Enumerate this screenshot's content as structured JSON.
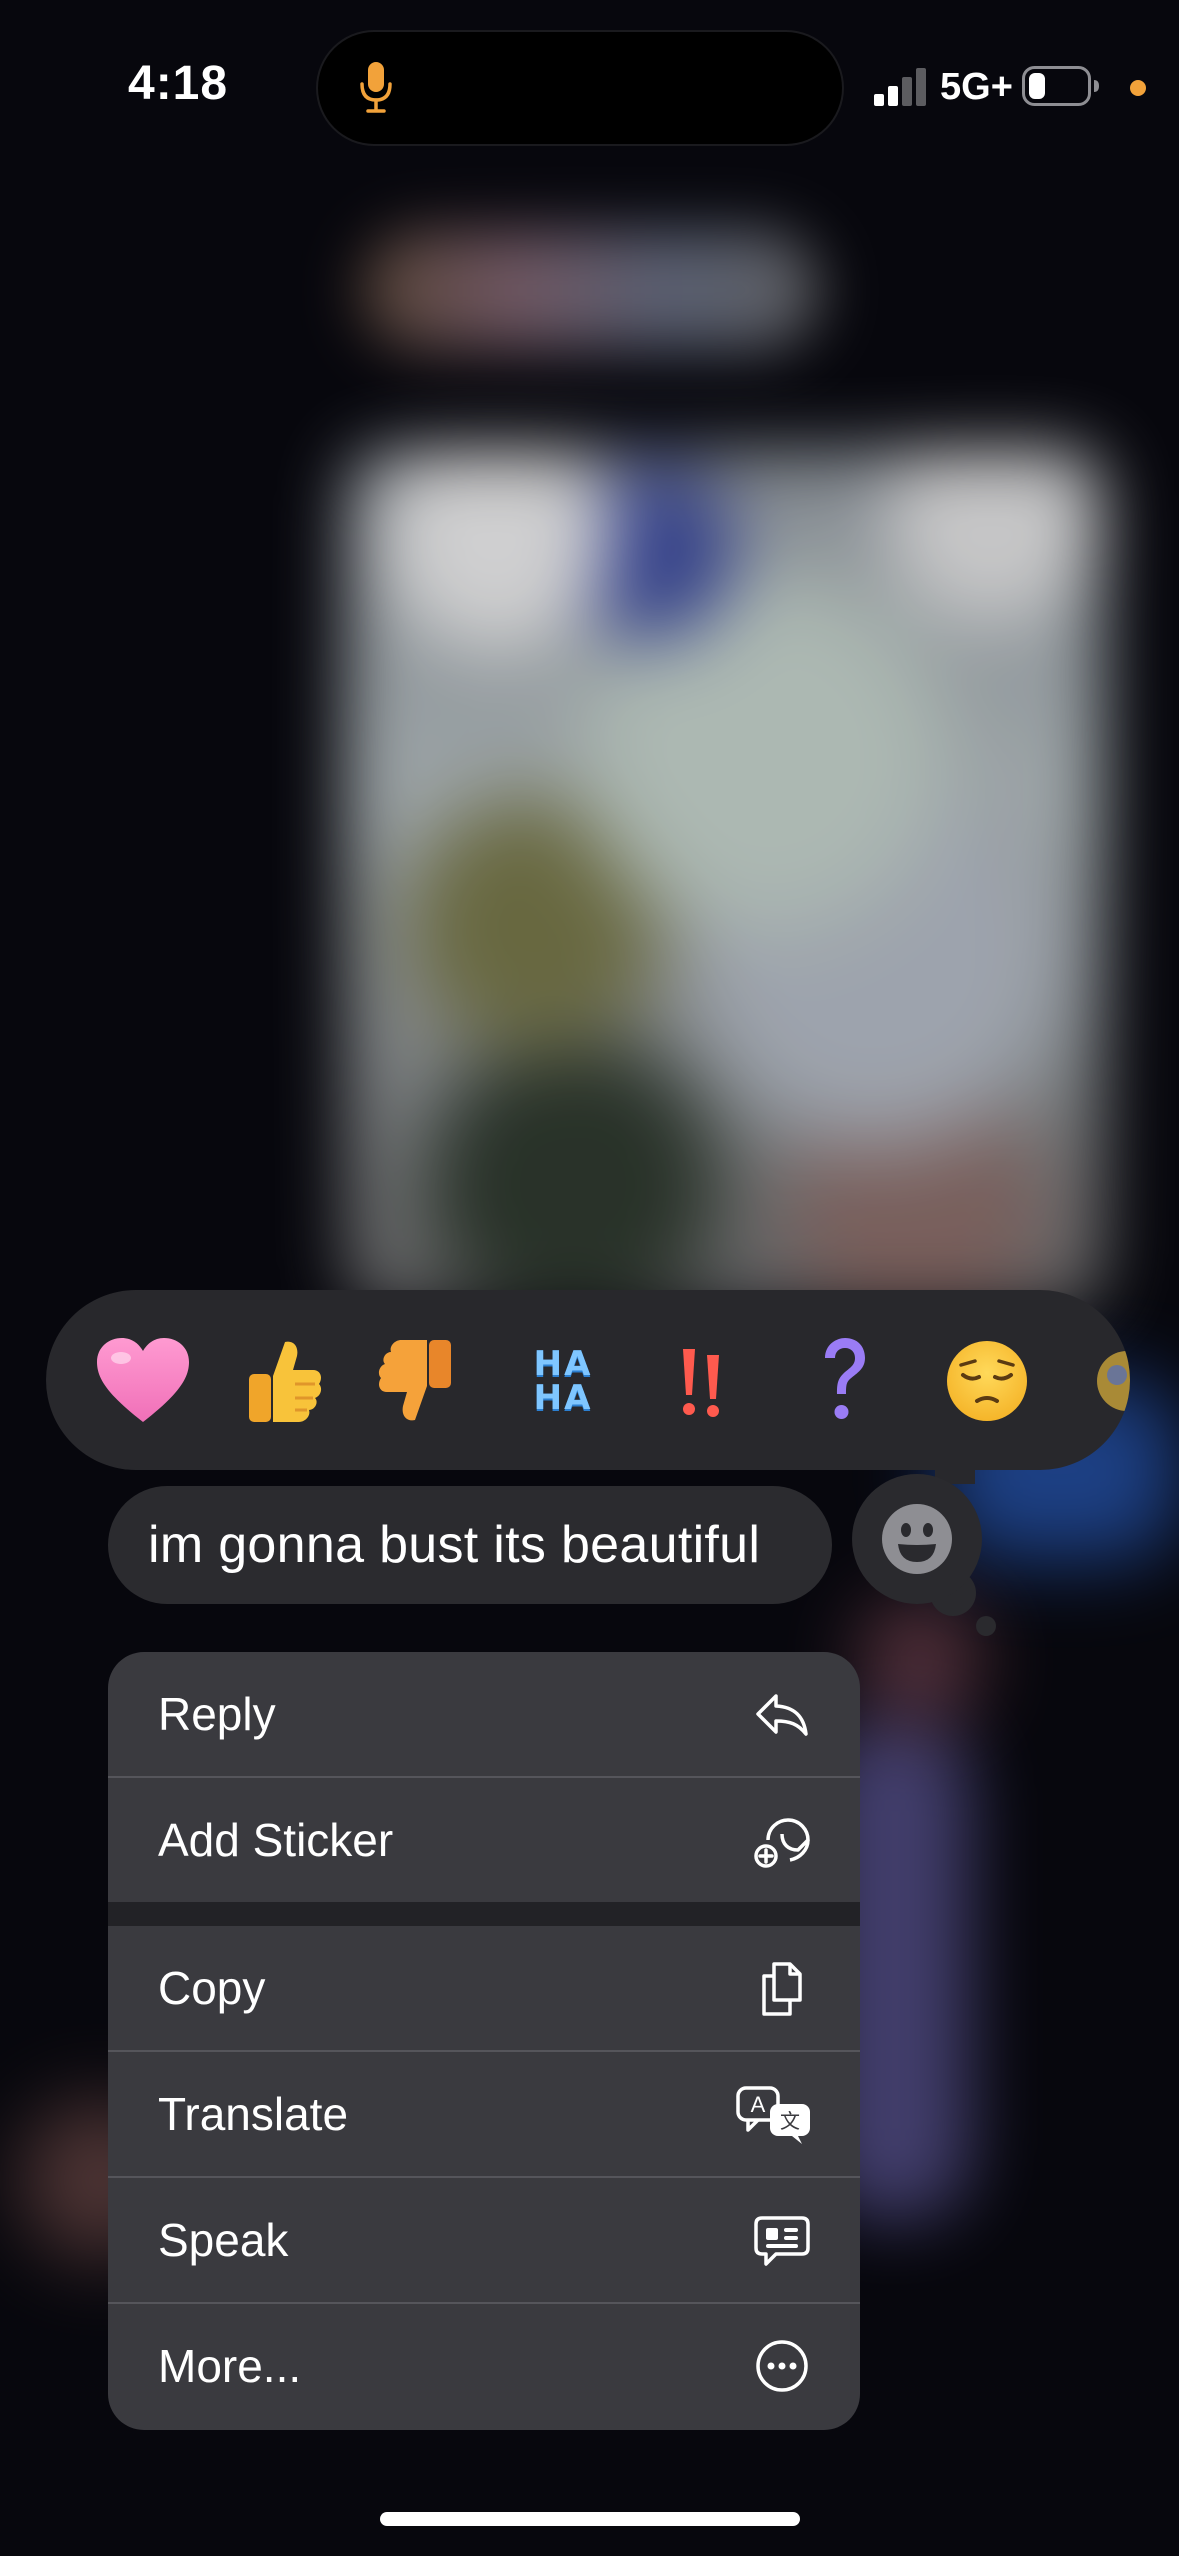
{
  "status_bar": {
    "time": "4:18",
    "network": "5G+",
    "mic_color": "#f2a23a",
    "privacy_dot_color": "#f2a23a"
  },
  "reactions": [
    {
      "name": "heart",
      "glyph": "❤️"
    },
    {
      "name": "thumbs-up",
      "glyph": "👍"
    },
    {
      "name": "thumbs-down",
      "glyph": "👎"
    },
    {
      "name": "haha",
      "line1": "HA",
      "line2": "HA"
    },
    {
      "name": "exclamation",
      "glyph": "‼"
    },
    {
      "name": "question",
      "glyph": "?"
    },
    {
      "name": "pensive-face",
      "glyph": "😔"
    }
  ],
  "message": {
    "text": "im gonna bust its beautiful"
  },
  "menu": {
    "items": [
      {
        "label": "Reply",
        "icon": "reply-icon"
      },
      {
        "label": "Add Sticker",
        "icon": "add-sticker-icon"
      },
      {
        "label": "Copy",
        "icon": "copy-icon"
      },
      {
        "label": "Translate",
        "icon": "translate-icon"
      },
      {
        "label": "Speak",
        "icon": "speak-icon"
      },
      {
        "label": "More...",
        "icon": "more-icon"
      }
    ]
  },
  "colors": {
    "menu_background": "#3a3a3f",
    "bubble_background": "#2b2b2f",
    "text": "#ffffff"
  }
}
